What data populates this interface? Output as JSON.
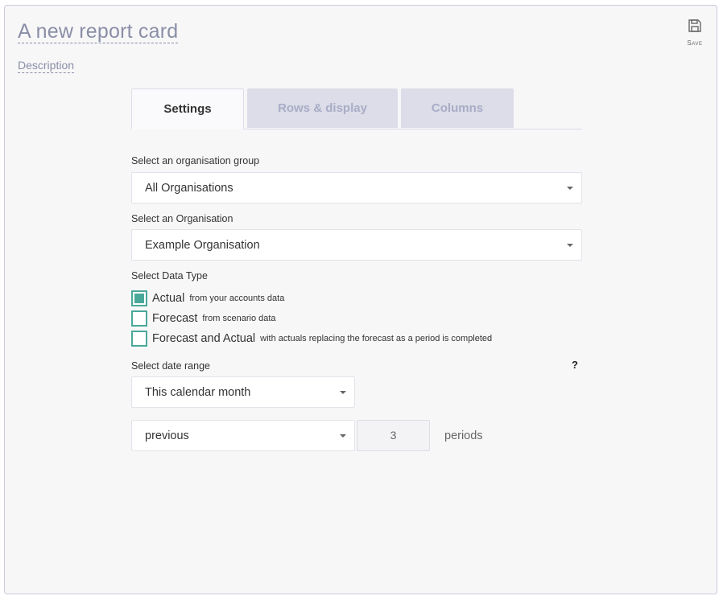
{
  "header": {
    "title": "A new report card",
    "description": "Description",
    "save_label": "Save"
  },
  "tabs": [
    {
      "label": "Settings",
      "active": true
    },
    {
      "label": "Rows & display",
      "active": false
    },
    {
      "label": "Columns",
      "active": false
    }
  ],
  "settings": {
    "org_group_label": "Select an organisation group",
    "org_group_value": "All Organisations",
    "org_label": "Select an Organisation",
    "org_value": "Example Organisation",
    "data_type_label": "Select Data Type",
    "data_types": [
      {
        "label": "Actual",
        "sub": "from your accounts data",
        "checked": true
      },
      {
        "label": "Forecast",
        "sub": "from scenario data",
        "checked": false
      },
      {
        "label": "Forecast and Actual",
        "sub": "with actuals replacing the forecast as a period is completed",
        "checked": false
      }
    ],
    "date_range_label": "Select date range",
    "help_symbol": "?",
    "date_range_value": "This calendar month",
    "direction_value": "previous",
    "periods_value": "3",
    "periods_label": "periods"
  },
  "colors": {
    "accent": "#4aa89a",
    "muted_text": "#8a8ea6",
    "inactive_tab_bg": "#dcdde8"
  }
}
